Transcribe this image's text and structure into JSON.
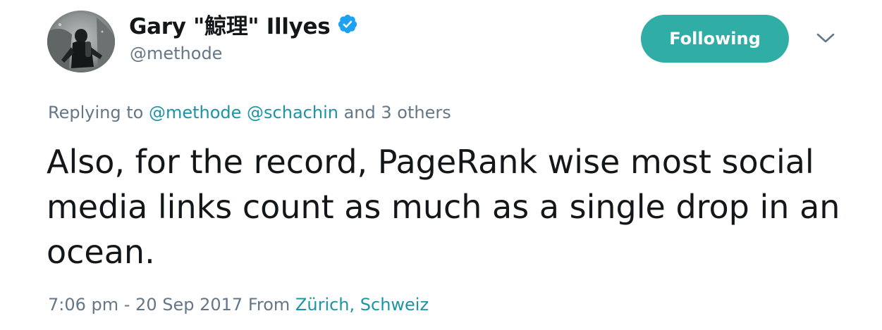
{
  "author": {
    "display_name": "Gary \"鯨理\" Illyes",
    "handle": "@methode",
    "verified_icon": "verified-badge-icon",
    "avatar_icon": "diver-photo-avatar"
  },
  "follow_button": {
    "label": "Following",
    "color": "#30aea6"
  },
  "menu": {
    "icon": "chevron-down-icon"
  },
  "replying": {
    "prefix": "Replying to",
    "mention_1": "@methode",
    "mention_2": "@schachin",
    "suffix": "and 3 others"
  },
  "tweet": {
    "text": "Also, for the record, PageRank wise most social media links count as much as a single drop in an ocean."
  },
  "meta": {
    "timestamp": "7:06 pm - 20 Sep 2017",
    "from_label": "From",
    "location": "Zürich, Schweiz"
  },
  "colors": {
    "link": "#1c94a6",
    "muted": "#657786",
    "text": "#14171a",
    "verified": "#1da1f2"
  }
}
